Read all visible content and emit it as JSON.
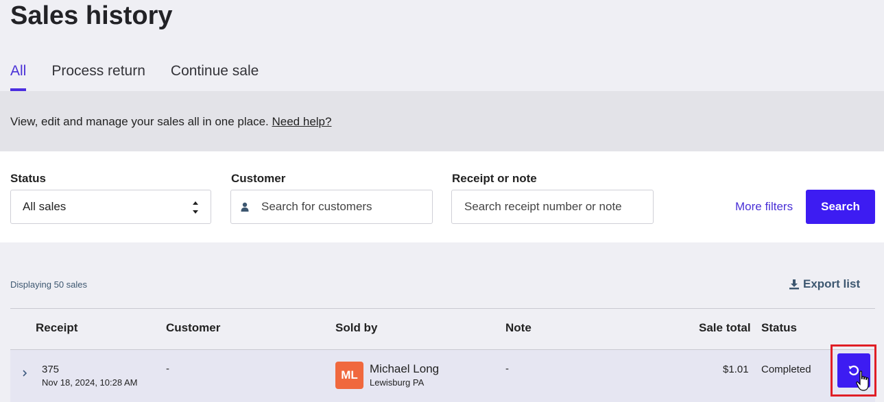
{
  "header": {
    "title": "Sales history"
  },
  "tabs": [
    {
      "label": "All",
      "active": true
    },
    {
      "label": "Process return",
      "active": false
    },
    {
      "label": "Continue sale",
      "active": false
    }
  ],
  "info": {
    "text": "View, edit and manage your sales all in one place.",
    "help_link": "Need help?"
  },
  "filters": {
    "status": {
      "label": "Status",
      "value": "All sales"
    },
    "customer": {
      "label": "Customer",
      "placeholder": "Search for customers",
      "icon": "person-icon"
    },
    "receipt": {
      "label": "Receipt or note",
      "placeholder": "Search receipt number or note"
    },
    "more_filters": "More filters",
    "search_button": "Search"
  },
  "list": {
    "count_text": "Displaying 50 sales",
    "export_label": "Export list",
    "export_icon": "download-icon",
    "columns": {
      "receipt": "Receipt",
      "customer": "Customer",
      "sold_by": "Sold by",
      "note": "Note",
      "sale_total": "Sale total",
      "status": "Status"
    },
    "rows": [
      {
        "receipt": "375",
        "date": "Nov 18, 2024, 10:28 AM",
        "customer": "-",
        "seller_initials": "ML",
        "seller_name": "Michael Long",
        "seller_location": "Lewisburg PA",
        "note": "-",
        "total": "$1.01",
        "status": "Completed",
        "action_icon": "return-icon"
      }
    ]
  },
  "colors": {
    "accent": "#3d1cf2",
    "tab_active": "#4930d6",
    "avatar": "#f0683e",
    "highlight": "#e01e25",
    "background": "#efeff4"
  }
}
